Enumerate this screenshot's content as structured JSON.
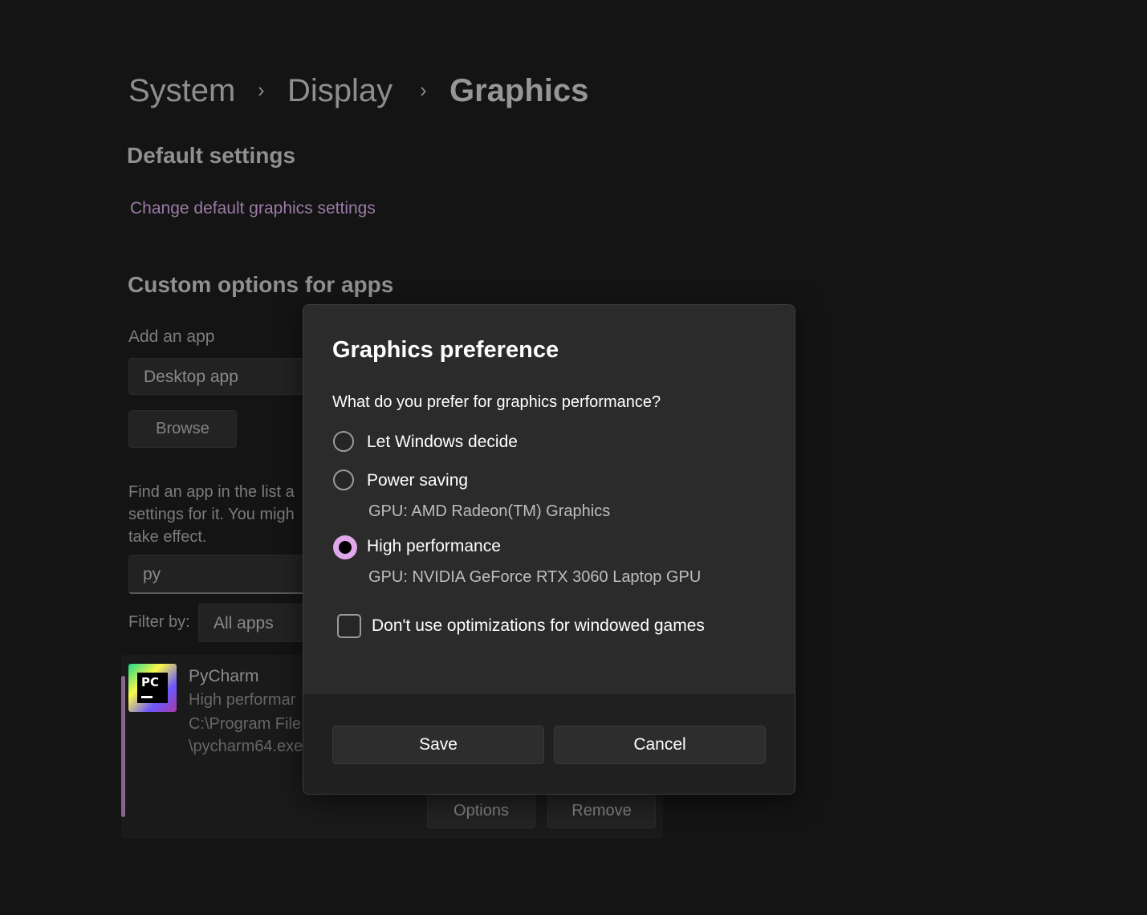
{
  "breadcrumb": {
    "items": [
      "System",
      "Display",
      "Graphics"
    ],
    "separator": "›"
  },
  "default_settings": {
    "heading": "Default settings",
    "link": "Change default graphics settings"
  },
  "custom": {
    "heading": "Custom options for apps",
    "add_app_label": "Add an app",
    "app_type_value": "Desktop app",
    "browse_label": "Browse",
    "find_text_line1": "Find an app in the list a",
    "find_text_line2": "settings for it. You migh",
    "find_text_line3": "take effect.",
    "search_value": "py",
    "filter_label": "Filter by:",
    "filter_value": "All apps"
  },
  "app": {
    "name": "PyCharm",
    "pref": "High performar",
    "path_line1": "C:\\Program File",
    "path_line2": "\\pycharm64.exe",
    "icon_text": "PC",
    "options_label": "Options",
    "remove_label": "Remove"
  },
  "dialog": {
    "title": "Graphics preference",
    "question": "What do you prefer for graphics performance?",
    "options": [
      {
        "label": "Let Windows decide",
        "gpu": "",
        "selected": false
      },
      {
        "label": "Power saving",
        "gpu": "GPU: AMD Radeon(TM) Graphics",
        "selected": false
      },
      {
        "label": "High performance",
        "gpu": "GPU: NVIDIA GeForce RTX 3060 Laptop GPU",
        "selected": true
      }
    ],
    "checkbox_label": "Don't use optimizations for windowed games",
    "checkbox_checked": false,
    "save_label": "Save",
    "cancel_label": "Cancel"
  },
  "colors": {
    "accent": "#e0a7ea",
    "link": "#9c7aa7",
    "dialog_bg": "#2b2b2b",
    "page_bg": "#141414"
  }
}
